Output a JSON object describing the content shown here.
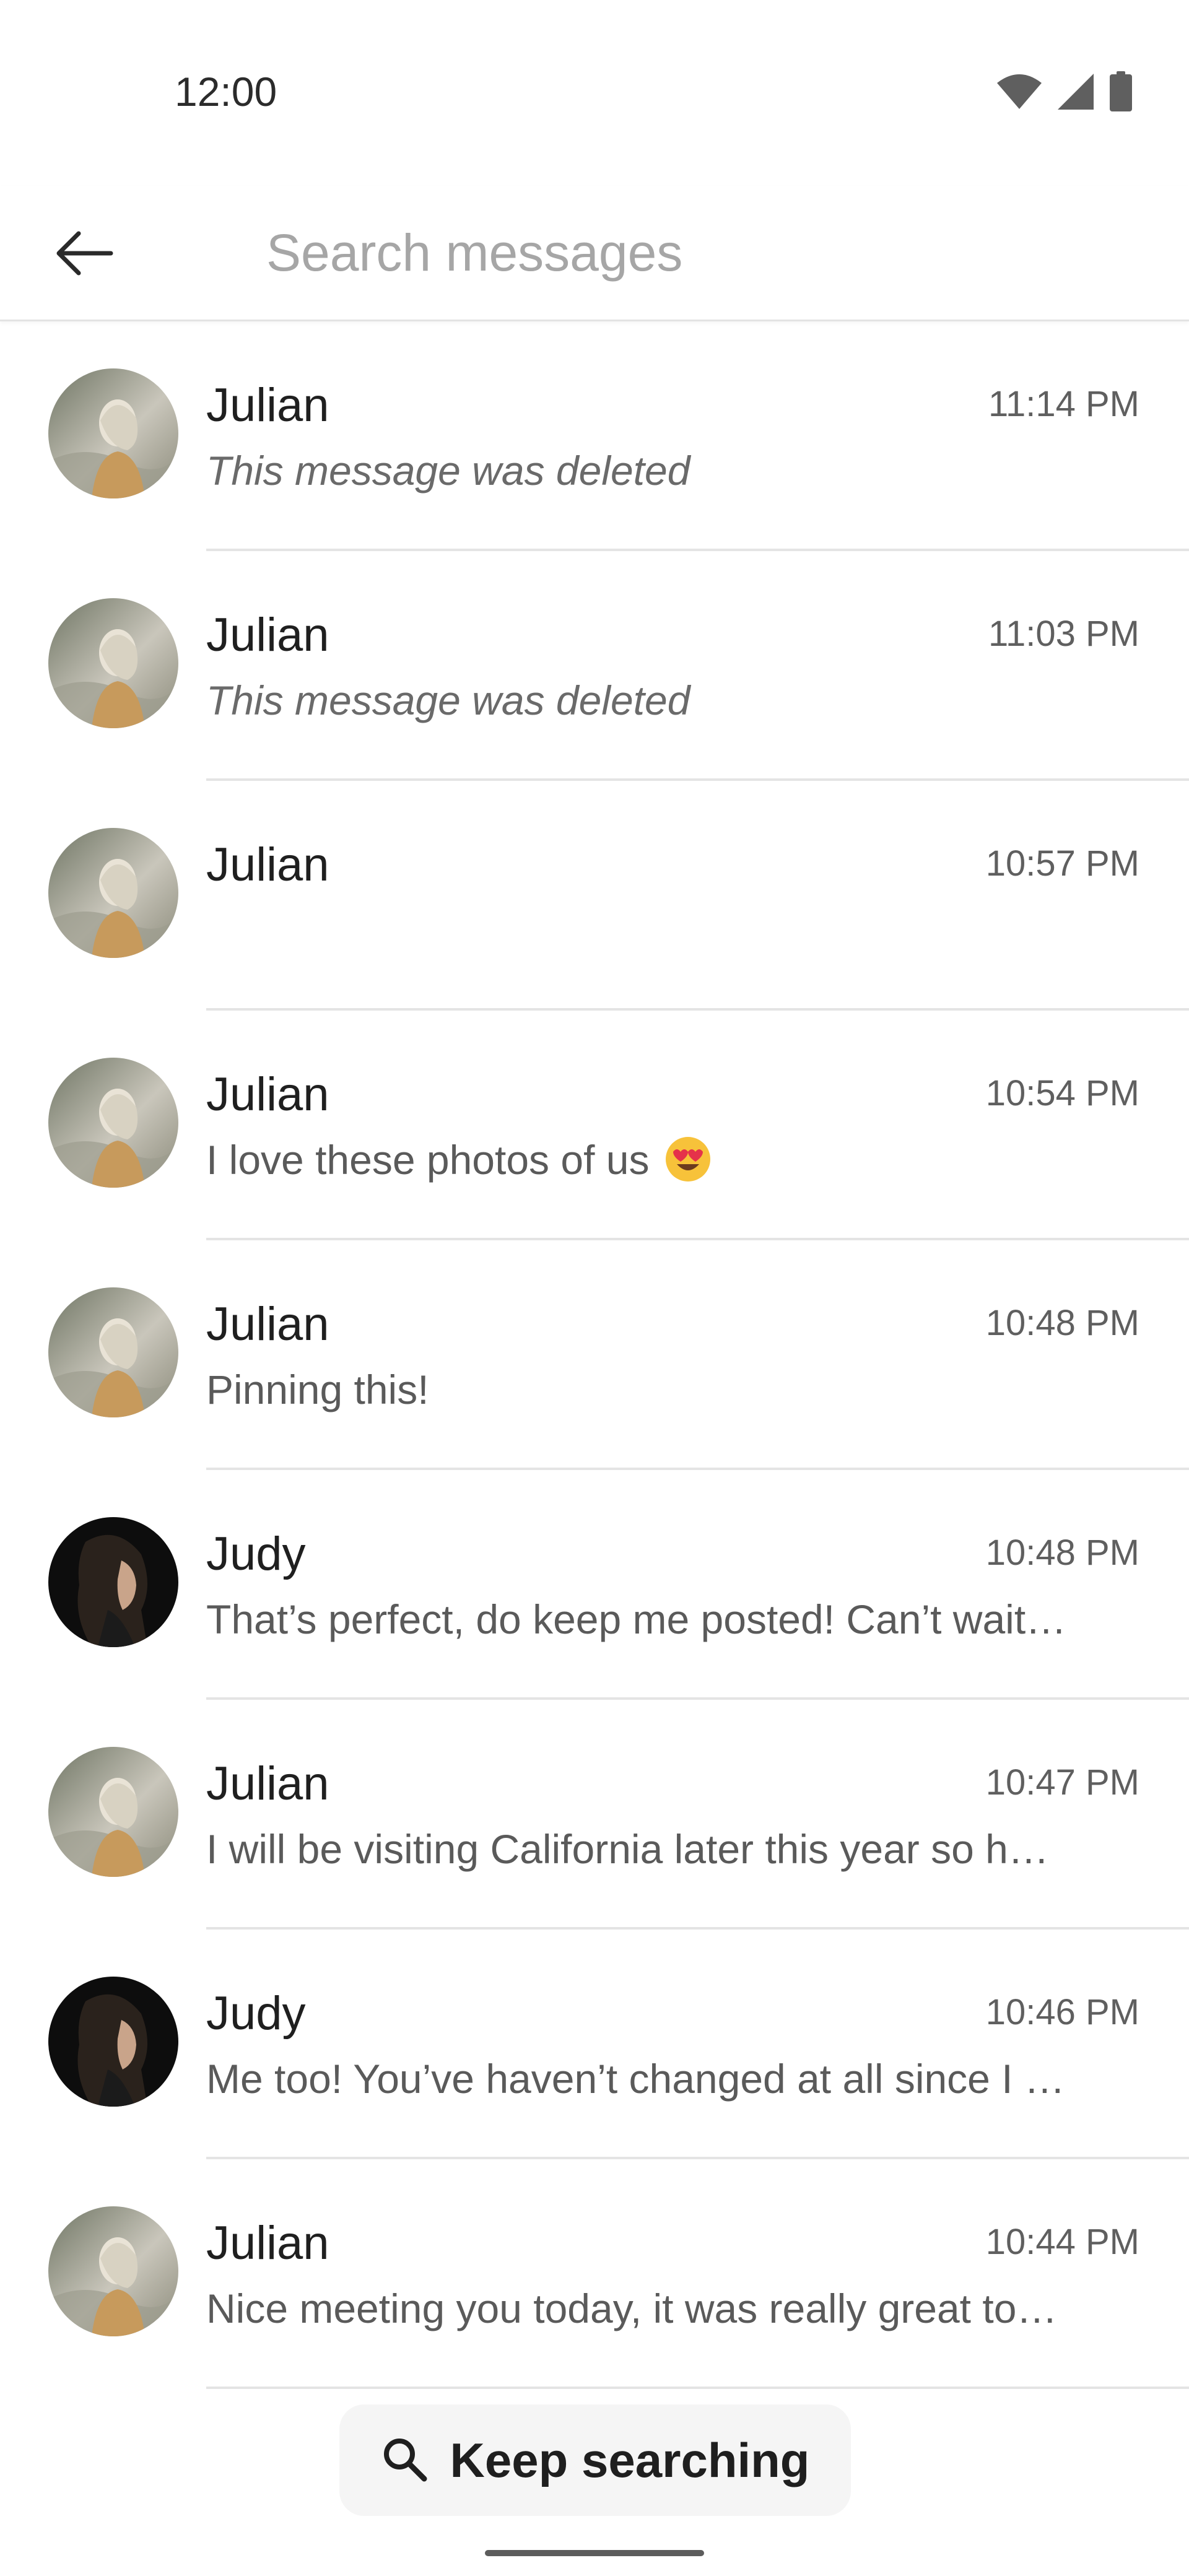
{
  "status_bar": {
    "time": "12:00",
    "icons": [
      "wifi-icon",
      "cell-signal-icon",
      "battery-icon"
    ]
  },
  "top_bar": {
    "back_icon": "arrow-back-icon",
    "search": {
      "value": "",
      "placeholder": "Search messages"
    }
  },
  "results": [
    {
      "name": "Julian",
      "time": "11:14 PM",
      "preview": "This message was deleted",
      "deleted": true,
      "avatar": "julian"
    },
    {
      "name": "Julian",
      "time": "11:03 PM",
      "preview": "This message was deleted",
      "deleted": true,
      "avatar": "julian"
    },
    {
      "name": "Julian",
      "time": "10:57 PM",
      "preview": "",
      "deleted": false,
      "avatar": "julian"
    },
    {
      "name": "Julian",
      "time": "10:54 PM",
      "preview": "I love these photos of us",
      "emoji": "heart-eyes-emoji",
      "deleted": false,
      "avatar": "julian"
    },
    {
      "name": "Julian",
      "time": "10:48 PM",
      "preview": "Pinning this!",
      "deleted": false,
      "avatar": "julian"
    },
    {
      "name": "Judy",
      "time": "10:48 PM",
      "preview": "That’s perfect, do keep me posted! Can’t wait…",
      "deleted": false,
      "avatar": "judy"
    },
    {
      "name": "Julian",
      "time": "10:47 PM",
      "preview": "I will be visiting California later this year so h…",
      "deleted": false,
      "avatar": "julian"
    },
    {
      "name": "Judy",
      "time": "10:46 PM",
      "preview": "Me too! You’ve haven’t changed at all since I …",
      "deleted": false,
      "avatar": "judy"
    },
    {
      "name": "Julian",
      "time": "10:44 PM",
      "preview": "Nice meeting you today, it was really great to…",
      "deleted": false,
      "avatar": "julian"
    }
  ],
  "keep_searching": {
    "label": "Keep searching",
    "icon": "search-icon"
  },
  "colors": {
    "divider": "#e4e4e4",
    "placeholder": "#a6a6a6",
    "button_bg": "#f5f5f5"
  }
}
